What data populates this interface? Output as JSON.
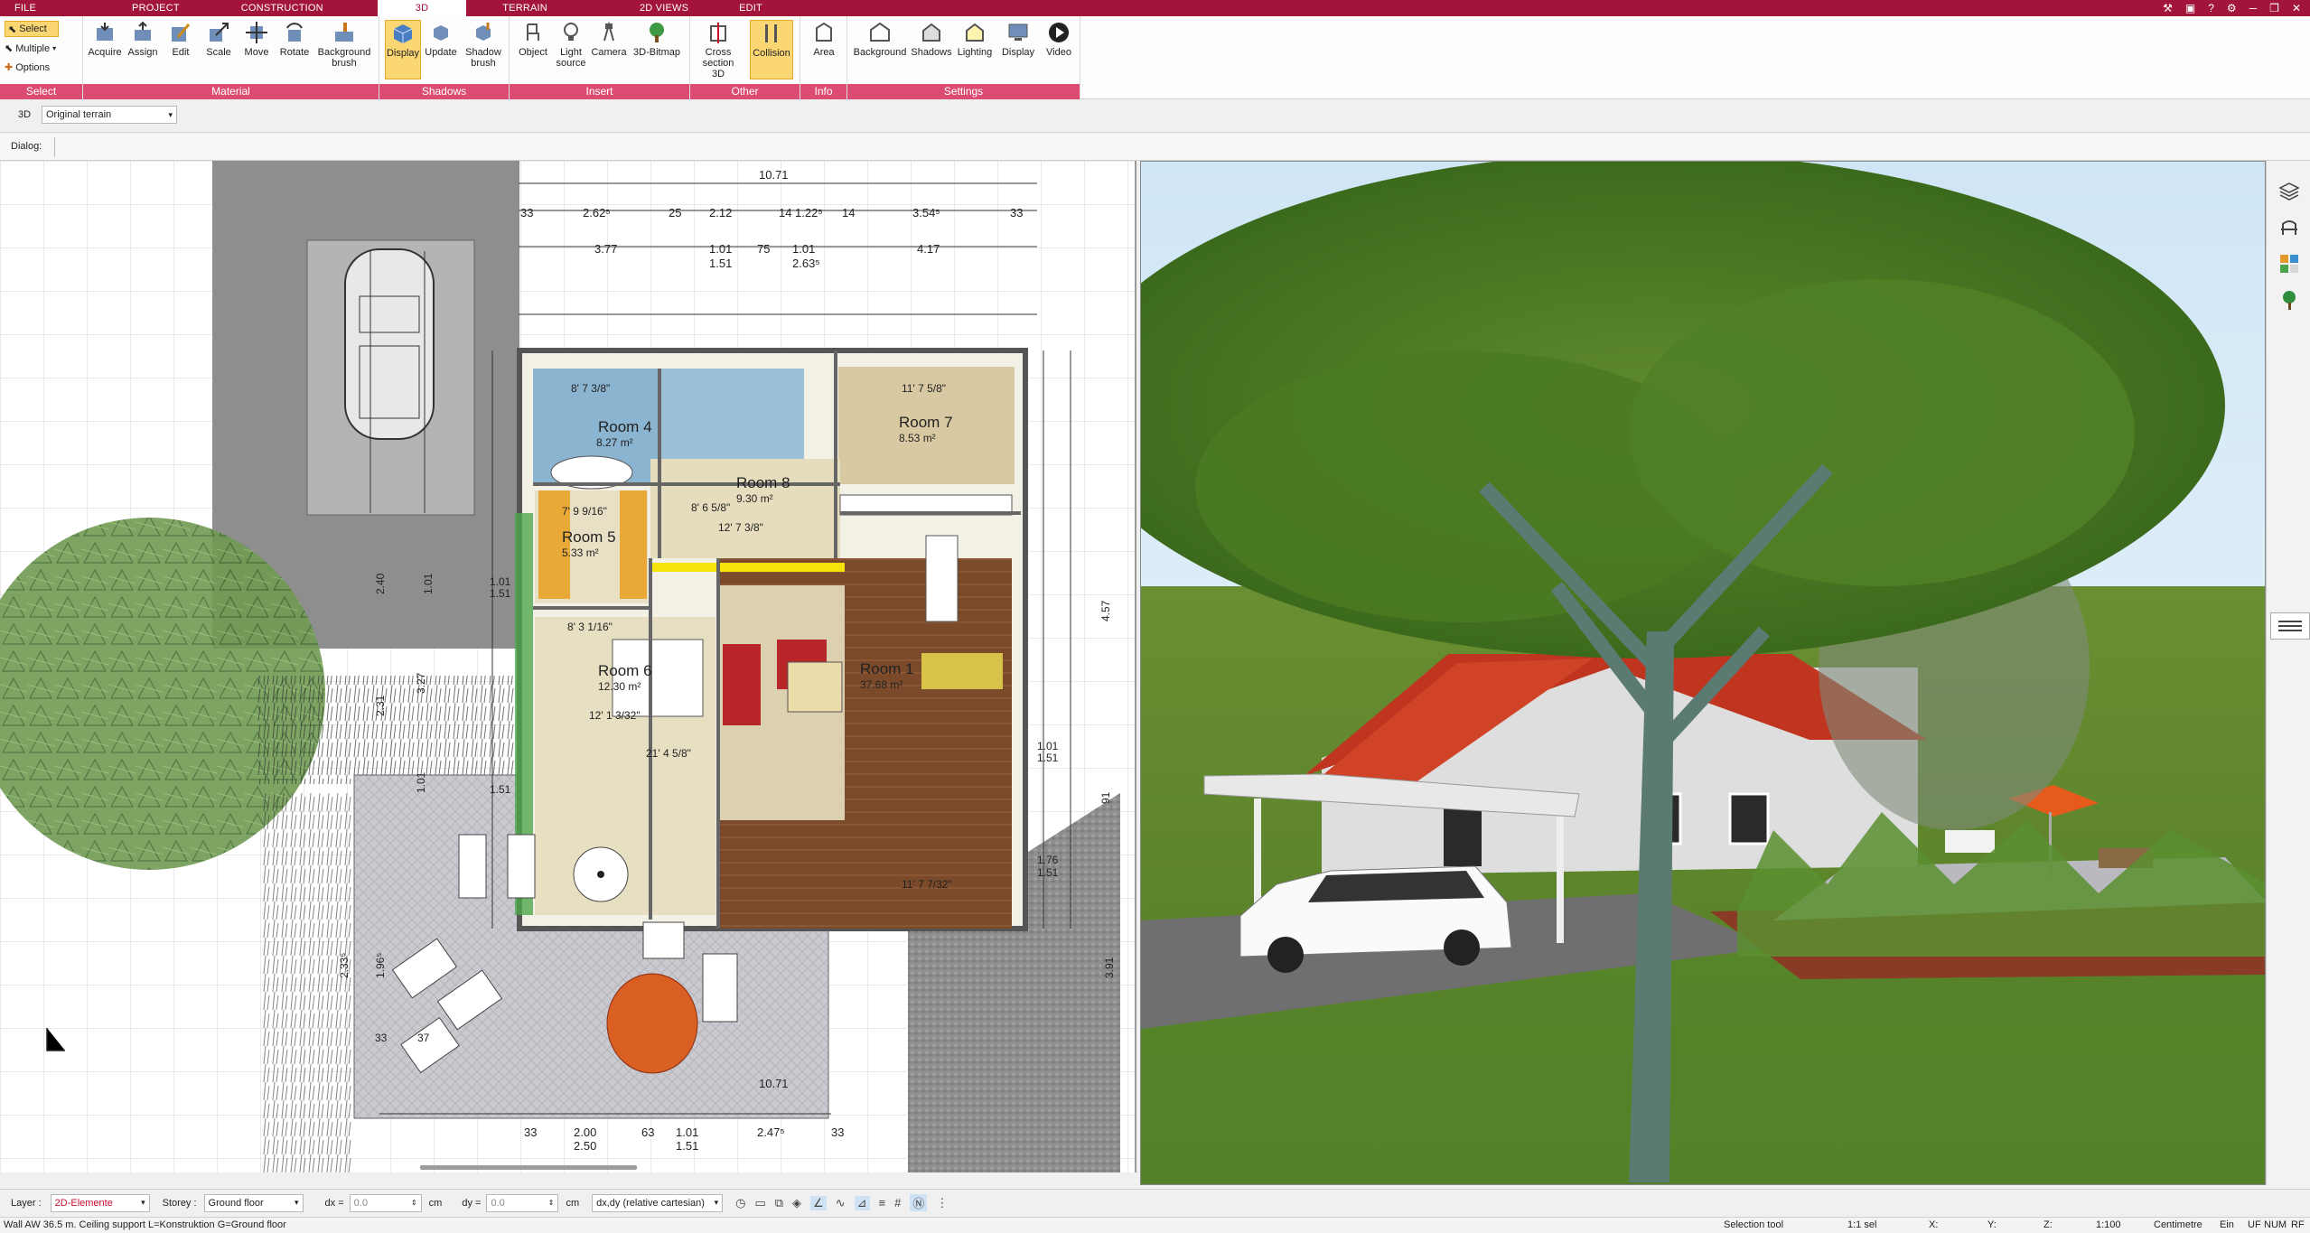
{
  "tabs": [
    "FILE",
    "PROJECT",
    "CONSTRUCTION",
    "3D",
    "TERRAIN",
    "2D VIEWS",
    "EDIT"
  ],
  "active_tab": "3D",
  "select": {
    "select_label": "Select",
    "multiple_label": "Multiple",
    "options_label": "Options"
  },
  "groups": {
    "select": "Select",
    "material": "Material",
    "shadows": "Shadows",
    "insert": "Insert",
    "other": "Other",
    "info": "Info",
    "settings": "Settings"
  },
  "buttons": {
    "acquire": "Acquire",
    "assign": "Assign",
    "edit": "Edit",
    "scale": "Scale",
    "move": "Move",
    "rotate": "Rotate",
    "background_brush_1": "Background",
    "background_brush_2": "brush",
    "display": "Display",
    "update": "Update",
    "shadow_brush_1": "Shadow",
    "shadow_brush_2": "brush",
    "object": "Object",
    "light_source_1": "Light",
    "light_source_2": "source",
    "camera": "Camera",
    "bitmap": "3D-Bitmap",
    "cross_section_1": "Cross",
    "cross_section_2": "section 3D",
    "collision": "Collision",
    "area": "Area",
    "background": "Background",
    "shadows": "Shadows",
    "lighting": "Lighting",
    "display2": "Display",
    "video": "Video"
  },
  "viewbar": {
    "mode": "3D",
    "terrain": "Original terrain"
  },
  "dialog_label": "Dialog:",
  "plan": {
    "dims_top": [
      "10.71",
      "2.62⁵",
      "25",
      "2.12",
      "14",
      "1.22⁵",
      "14",
      "3.54⁵",
      "33",
      "33",
      "3.77",
      "1.01",
      "1.51",
      "75",
      "1.01",
      "2.63⁵",
      "4.17"
    ],
    "rooms": [
      {
        "name": "Room 4",
        "area": "8.27 m²"
      },
      {
        "name": "Room 7",
        "area": "8.53 m²"
      },
      {
        "name": "Room 8",
        "area": "9.30 m²"
      },
      {
        "name": "Room 5",
        "area": "5.33 m²"
      },
      {
        "name": "Room 6",
        "area": "12.30 m²"
      },
      {
        "name": "Room 1",
        "area": "37.68 m²"
      }
    ],
    "imperial": [
      "8' 7 3/8\"",
      "11' 7 5/8\"",
      "7' 9 9/16\"",
      "8' 6 5/8\"",
      "12' 7 3/8\"",
      "8' 3 1/16\"",
      "12' 1 3/32\"",
      "21' 4 5/8\"",
      "11' 7 7/32\""
    ],
    "right_dims": [
      "4.57",
      "1.01",
      "1.51",
      "91",
      "1.76",
      "1.51",
      "3.91"
    ],
    "left_dims": [
      "1.01",
      "1.51",
      "2.40",
      "1.01",
      "3.27",
      "2.31",
      "1.01",
      "1.51",
      "2.33⁵",
      "1.96⁵",
      "33",
      "37"
    ],
    "terrace_dims": [
      "2.00",
      "2.50",
      "63",
      "1.01",
      "1.51",
      "2.47⁵",
      "33",
      "33",
      "10.71"
    ]
  },
  "bottom": {
    "layer_label": "Layer :",
    "layer_value": "2D-Elemente",
    "storey_label": "Storey :",
    "storey_value": "Ground floor",
    "dx_label": "dx =",
    "dx_value": "0.0",
    "dy_label": "dy =",
    "dy_value": "0.0",
    "unit": "cm",
    "coord_mode": "dx,dy (relative cartesian)"
  },
  "status": {
    "message": "Wall AW 36.5 m. Ceiling support L=Konstruktion G=Ground floor",
    "tool": "Selection tool",
    "sel": "1:1 sel",
    "x": "X:",
    "y": "Y:",
    "z": "Z:",
    "scale": "1:100",
    "unit": "Centimetre",
    "ein": "Ein",
    "uf": "UF",
    "num": "NUM",
    "rf": "RF"
  },
  "colors": {
    "accent": "#a3143a",
    "ribbon_caption": "#dc4c72",
    "active_button": "#fbd774"
  }
}
